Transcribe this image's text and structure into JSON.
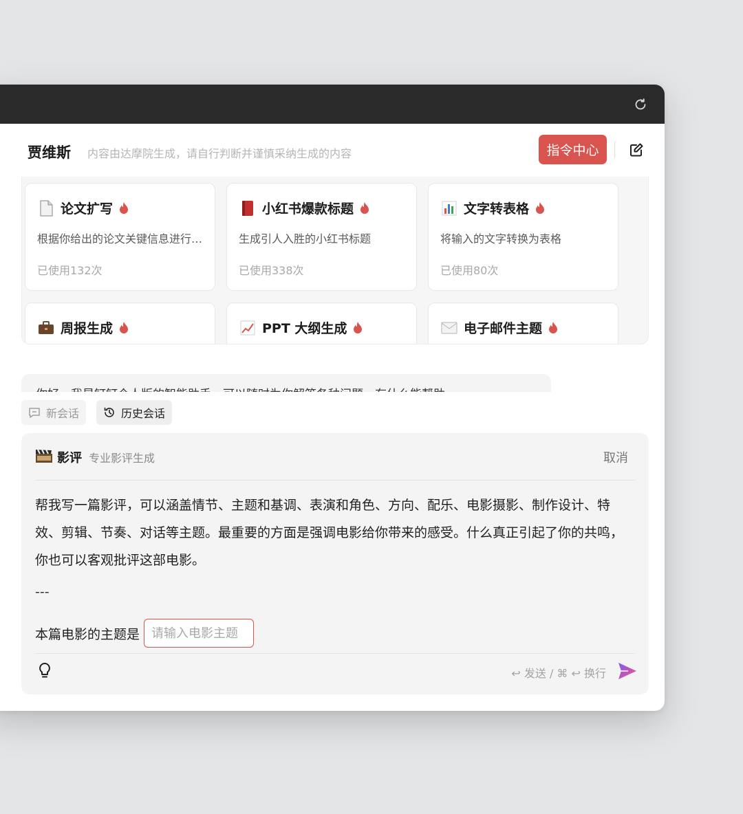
{
  "app": {
    "title": "贾维斯",
    "disclaimer": "内容由达摩院生成，请自行判断并谨慎采纳生成的内容",
    "command_center_label": "指令中心"
  },
  "colors": {
    "accent": "#d9534f",
    "titlebar": "#2a2a2a",
    "panel": "#f4f4f5"
  },
  "cards": [
    {
      "icon": "page-icon",
      "title": "论文扩写",
      "desc": "根据你给出的论文关键信息进行扩写，生成一篇完整的论文",
      "usage": "已使用132次"
    },
    {
      "icon": "red-book-icon",
      "title": "小红书爆款标题",
      "desc": "生成引人入胜的小红书标题",
      "usage": "已使用338次"
    },
    {
      "icon": "bar-chart-icon",
      "title": "文字转表格",
      "desc": "将输入的文字转换为表格",
      "usage": "已使用80次"
    },
    {
      "icon": "briefcase-icon",
      "title": "周报生成",
      "desc": "",
      "usage": ""
    },
    {
      "icon": "line-chart-icon",
      "title": "PPT 大纲生成",
      "desc": "",
      "usage": ""
    },
    {
      "icon": "envelope-icon",
      "title": "电子邮件主题",
      "desc": "",
      "usage": ""
    }
  ],
  "greeting": "你好，我是钉钉个人版的智能助手，可以随时为你解答各种问题，有什么能帮助",
  "session": {
    "new_label": "新会话",
    "history_label": "历史会话"
  },
  "composer": {
    "command_name": "影评",
    "command_desc": "专业影评生成",
    "cancel_label": "取消",
    "prompt": "帮我写一篇影评，可以涵盖情节、主题和基调、表演和角色、方向、配乐、电影摄影、制作设计、特效、剪辑、节奏、对话等主题。最重要的方面是强调电影给你带来的感受。什么真正引起了你的共鸣，你也可以客观批评这部电影。",
    "separator": "---",
    "topic_label": "本篇电影的主题是",
    "topic_placeholder": "请输入电影主题",
    "hint": "↩ 发送 / ⌘ ↩ 换行"
  }
}
